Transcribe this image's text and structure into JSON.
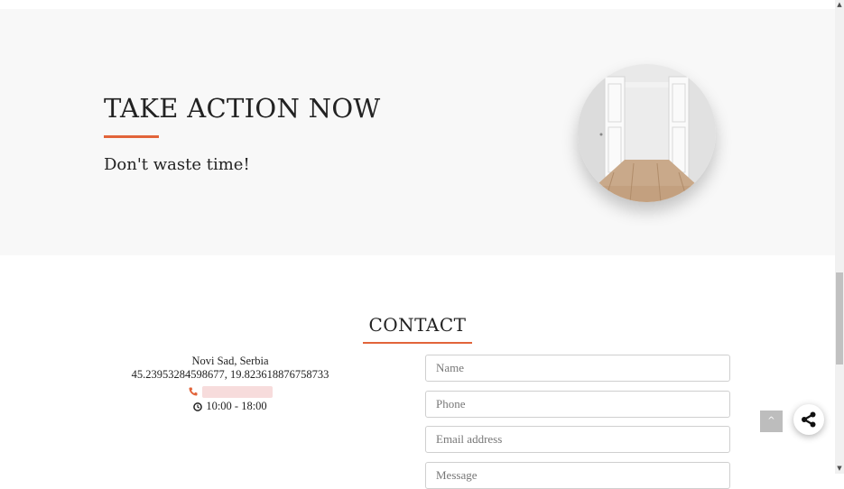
{
  "hero": {
    "title": "TAKE ACTION NOW",
    "subtitle": "Don't waste time!",
    "photo_icon": "open-door-room-photo"
  },
  "contact": {
    "title": "CONTACT",
    "city": "Novi Sad, Serbia",
    "coordinates": "45.23953284598677, 19.823618876758733",
    "hours": "10:00 - 18:00",
    "phone_icon": "phone-icon",
    "clock_icon": "clock-icon"
  },
  "form": {
    "name_placeholder": "Name",
    "phone_placeholder": "Phone",
    "email_placeholder": "Email address",
    "message_placeholder": "Message"
  },
  "controls": {
    "back_to_top": "^",
    "share_icon": "share-icon"
  },
  "colors": {
    "accent": "#e2643a",
    "hero_background": "#f8f8f8"
  }
}
